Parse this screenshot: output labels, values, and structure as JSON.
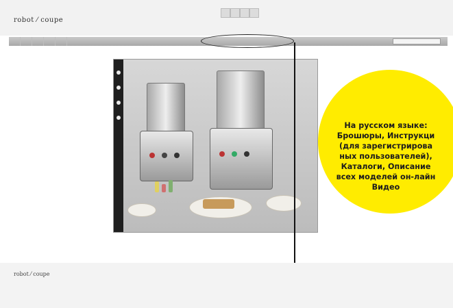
{
  "header": {
    "logo": "robot ⁄ coupe",
    "top_links": [
      "",
      "",
      "",
      ""
    ],
    "nav_items": [
      "",
      "",
      "",
      "",
      ""
    ],
    "search_placeholder": ""
  },
  "sidebar": {
    "items": [
      "",
      "",
      "",
      "",
      "",
      "",
      "",
      ""
    ]
  },
  "footer": {
    "logo": "robot ⁄ coupe",
    "links": "",
    "note": ""
  },
  "callout": {
    "lines": [
      "На русском языке:",
      "Брошюры, Инструкци",
      "(для зарегистрирова",
      "ных пользователей),",
      "Каталоги, Описание",
      "всех моделей он-лайн",
      "Видео"
    ],
    "background_color": "#ffec00"
  },
  "icons": {
    "arrow": "down-arrow-icon",
    "highlight": "ellipse-highlight"
  }
}
